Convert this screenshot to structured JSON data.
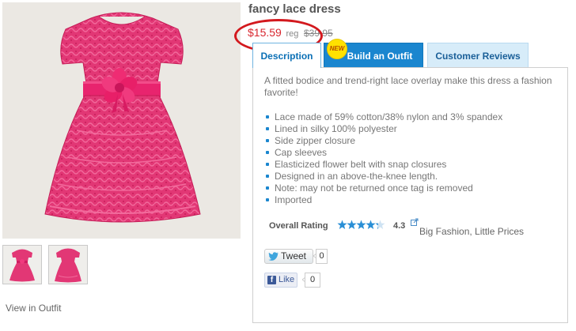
{
  "product": {
    "title": "fancy lace dress",
    "sale_price": "$15.59",
    "reg_label": "reg",
    "reg_price": "$39.95"
  },
  "gallery": {
    "main_image": "pink lace dress with flower belt",
    "thumbnails": [
      "dress front thumbnail",
      "dress alternate thumbnail"
    ],
    "view_in_outfit": "View in Outfit"
  },
  "tabs": [
    {
      "label": "Description",
      "active": true
    },
    {
      "label": "Build an Outfit",
      "badge": "NEW"
    },
    {
      "label": "Customer Reviews"
    }
  ],
  "description": {
    "lead": "A fitted bodice and trend-right lace overlay make this dress a fashion favorite!",
    "features": [
      "Lace made of 59% cotton/38% nylon and 3% spandex",
      "Lined in silky 100% polyester",
      "Side zipper closure",
      "Cap sleeves",
      "Elasticized flower belt with snap closures",
      "Designed in an above-the-knee length.",
      "Note: may not be returned once tag is removed",
      "Imported"
    ]
  },
  "rating": {
    "label": "Overall Rating",
    "value": "4.3",
    "stars_out_of_5": 4.3,
    "caption": "Big Fashion, Little Prices",
    "icon": "external-link-icon"
  },
  "social": {
    "tweet_label": "Tweet",
    "tweet_count": "0",
    "like_label": "Like",
    "like_count": "0"
  },
  "colors": {
    "sale_price": "#d8262e",
    "annotation_circle": "#d3191e",
    "tab_active_text": "#0a6fb5",
    "tab_outfit_bg": "#1a86cf",
    "tab_reviews_bg": "#d7ecf9",
    "star": "#2a8fd6",
    "dress_pink": "#e0306f"
  }
}
